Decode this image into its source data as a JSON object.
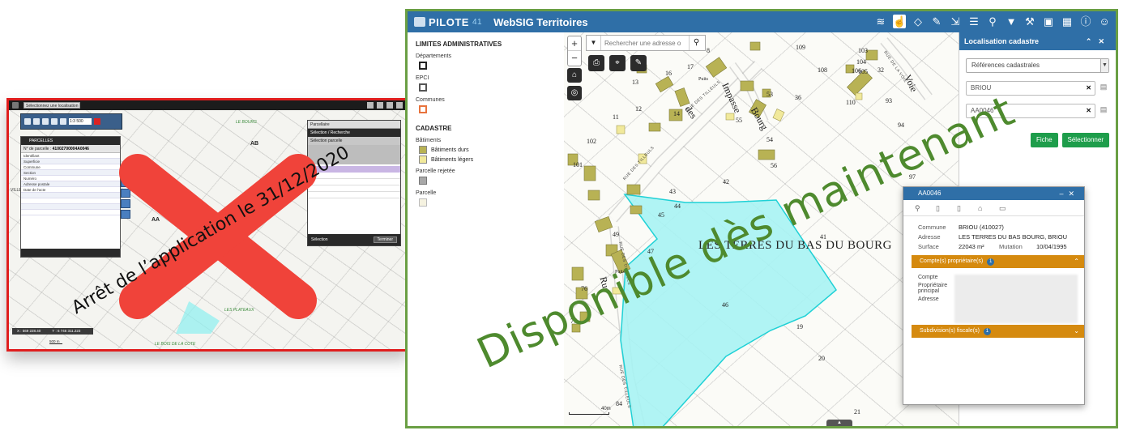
{
  "old_app": {
    "location_select": "Sélectionnez une localisation",
    "scale_value": "1:3 500",
    "parcel_panel": {
      "title": "PARCELLES",
      "parcel_id_label": "N° de parcelle",
      "parcel_id_value": "41002700004A0046",
      "rows": [
        "Identifiant",
        "Superficie",
        "Commune",
        "Section",
        "Numéro",
        "Adresse postale",
        "Date de l'acte"
      ]
    },
    "map_labels": [
      "PRE DES SALLES",
      "LE BOURG",
      "AB",
      "AA",
      "LES PLATEAUX",
      "LE BOIS DE LA COTE",
      "VILLE"
    ],
    "right_panel": {
      "select": "Parcellaire",
      "header": "Sélection / Recherche",
      "sub": "Sélection parcelle",
      "footer_label": "Sélection",
      "footer_button": "Terminer"
    },
    "coords": {
      "x": "X : 569 228.40",
      "y": "Y : 6 746 311.223"
    },
    "scale_bar": "500 m"
  },
  "stop_message": "Arrêt de l’application le 31/12/2020",
  "new_app": {
    "logo": "PILOTE",
    "logo_number": "41",
    "title": "WebSIG Territoires",
    "header_icons": [
      "layers-icon",
      "hand-pointer-icon",
      "tag-icon",
      "pencil-ruler-icon",
      "measure-icon",
      "layer-stack-icon",
      "person-search-icon",
      "filter-icon",
      "gavel-icon",
      "clipboard-icon",
      "grid-icon",
      "info-icon",
      "user-icon"
    ],
    "legend": {
      "admin_title": "LIMITES ADMINISTRATIVES",
      "departements": "Départements",
      "epci": "EPCI",
      "communes": "Communes",
      "cadastre_title": "CADASTRE",
      "batiments": "Bâtiments",
      "batiments_durs": "Bâtiments durs",
      "batiments_legers": "Bâtiments légers",
      "parcelle_rejetee": "Parcelle rejetée",
      "parcelle": "Parcelle",
      "colors": {
        "departements": "#222222",
        "epci": "#555555",
        "communes": "#e8733c",
        "batiments_durs": "#b8b254",
        "batiments_legers": "#f1e99b",
        "parcelle_rejetee": "#a8a8a8",
        "parcelle": "#f5f2e0"
      }
    },
    "map": {
      "search_placeholder": "Rechercher une adresse o",
      "lieu_dit": "LES TERRES DU BAS DU BOURG",
      "streets": {
        "impasse": "Impasse",
        "bourg": "Bourg",
        "des": "des",
        "voie": "Voie",
        "rue": "Rue",
        "tilleuls1": "RUE DES TILLEULS",
        "tilleuls2": "RUE DES TILLEULS",
        "tilleuls3": "RUE DES TILLEULS",
        "tilleuls4": "RUE DES TILLEULS",
        "tilleuls5": "RUE DE LA VOIE"
      },
      "parcel_numbers": [
        "8",
        "109",
        "103",
        "104",
        "105",
        "106",
        "32",
        "17",
        "16",
        "13",
        "Puits",
        "53",
        "36",
        "108",
        "110",
        "93",
        "12",
        "11",
        "14",
        "55",
        "54",
        "94",
        "102",
        "56",
        "101",
        "42",
        "97",
        "43",
        "44",
        "45",
        "49",
        "41",
        "47",
        "Puits",
        "76",
        "46",
        "77",
        "19",
        "20",
        "84",
        "21"
      ],
      "scale_label": "40m"
    },
    "loc_panel": {
      "title": "Localisation cadastre",
      "select": "Références cadastrales",
      "commune_value": "BRIOU",
      "parcel_value": "AA0046",
      "btn_fiche": "Fiche",
      "btn_select": "Sélectionner"
    },
    "parcel_popup": {
      "title": "AA0046",
      "commune_label": "Commune",
      "commune_value": "BRIOU (410027)",
      "adresse_label": "Adresse",
      "adresse_value": "LES TERRES DU BAS BOURG, BRIOU",
      "surface_label": "Surface",
      "surface_value": "22043 m²",
      "mutation_label": "Mutation",
      "mutation_value": "10/04/1995",
      "owners_bar": "Compte(s) propriétaire(s)",
      "owners_count": "1",
      "compte_label": "Compte",
      "proprietaire_label": "Propriétaire principal",
      "adresse2_label": "Adresse",
      "subdiv_bar": "Subdivision(s) fiscale(s)",
      "subdiv_count": "1"
    }
  },
  "available_message": "Disponible dès maintenant"
}
